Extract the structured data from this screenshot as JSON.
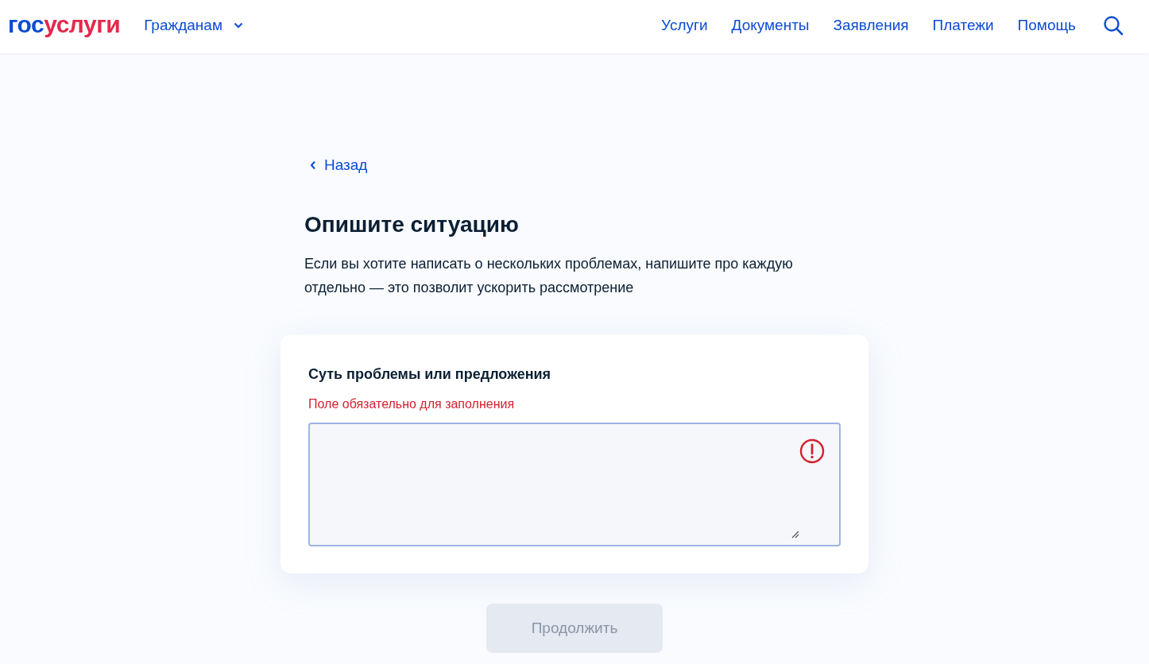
{
  "header": {
    "logo": {
      "first": "гос",
      "second": "услуги"
    },
    "audience": {
      "label": "Гражданам",
      "expanded": false
    },
    "nav": [
      {
        "label": "Услуги"
      },
      {
        "label": "Документы"
      },
      {
        "label": "Заявления"
      },
      {
        "label": "Платежи"
      },
      {
        "label": "Помощь"
      }
    ]
  },
  "back_link": "Назад",
  "title": "Опишите ситуацию",
  "description": "Если вы хотите написать о нескольких проблемах, напишите про каждую отдельно — это позволит ускорить рассмотрение",
  "form": {
    "label": "Суть проблемы или предложения",
    "error": true,
    "error_text": "Поле обязательно для заполнения"
  },
  "continue_button": {
    "label": "Продолжить",
    "disabled": true
  }
}
